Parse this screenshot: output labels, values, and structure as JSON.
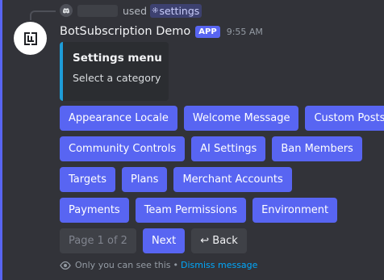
{
  "reply": {
    "used_text": "used",
    "command_icon": "slash-command-icon",
    "command_name": "settings"
  },
  "message": {
    "bot_name": "BotSubscription Demo",
    "app_badge": "APP",
    "timestamp": "9:55 AM",
    "avatar_icon": "bot-logo-icon"
  },
  "embed": {
    "title": "Settings menu",
    "description": "Select a category",
    "accent_color": "#1e9cd7"
  },
  "buttons": {
    "row1": [
      "Appearance Locale",
      "Welcome Message",
      "Custom Posts"
    ],
    "row2": [
      "Community Controls",
      "AI Settings",
      "Ban Members"
    ],
    "row3": [
      "Targets",
      "Plans",
      "Merchant Accounts"
    ],
    "row4": [
      "Payments",
      "Team Permissions",
      "Environment"
    ]
  },
  "pagination": {
    "page_label": "Page 1 of 2",
    "next_label": "Next",
    "back_label": "↩ Back"
  },
  "footer": {
    "ephemeral_text": "Only you can see this",
    "separator": "•",
    "dismiss_label": "Dismiss message",
    "eye_icon": "eye-icon"
  },
  "colors": {
    "background": "#323339",
    "primary_button": "#5865f2",
    "secondary_button": "#3f4147",
    "link": "#00a8fc"
  }
}
